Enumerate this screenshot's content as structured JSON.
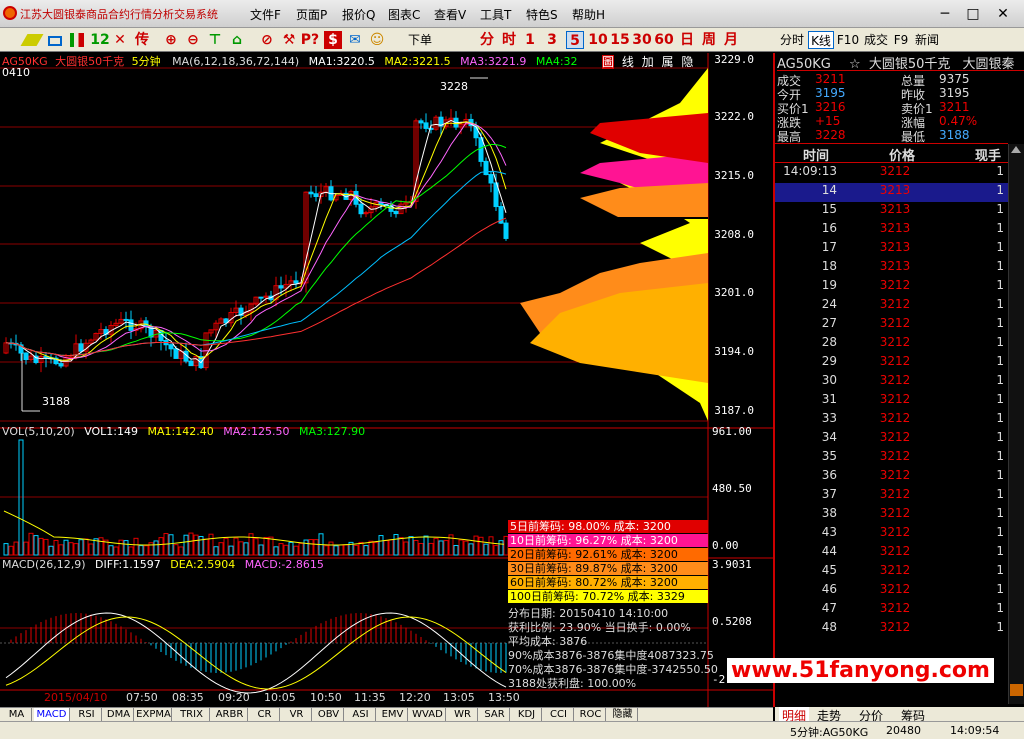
{
  "title": "江苏大圆银泰商品合约行情分析交易系统",
  "menu": [
    "文件F",
    "页面P",
    "报价Q",
    "图表C",
    "查看V",
    "工具T",
    "特色S",
    "帮助H"
  ],
  "window_buttons": [
    "─",
    "□",
    "✕"
  ],
  "toolbar": {
    "items": [
      "12",
      "传",
      "下单",
      "分",
      "时",
      "1",
      "3",
      "5",
      "10",
      "15",
      "30",
      "60",
      "日",
      "周",
      "月"
    ],
    "right_items": [
      "分时",
      "K线",
      "F10",
      "成交",
      "F9",
      "新闻"
    ]
  },
  "chart_header": {
    "symbol": "AG50KG",
    "name": "大圆银50千克",
    "period": "5分钟",
    "ma_label": "MA(6,12,18,36,72,144)",
    "ma1": "MA1:3220.5",
    "ma2": "MA2:3221.5",
    "ma3": "MA3:3221.9",
    "ma4": "MA4:32",
    "extra": "圖",
    "toggles": [
      "线",
      "加",
      "属",
      "隐"
    ],
    "date_tag": "0410"
  },
  "price_axis": [
    "3229.0",
    "3222.0",
    "3215.0",
    "3208.0",
    "3201.0",
    "3194.0",
    "3187.0"
  ],
  "price_labels": {
    "high": "3228",
    "low": "3188"
  },
  "vol_header": {
    "label": "VOL(5,10,20)",
    "vol1": "VOL1:149",
    "ma1": "MA1:142.40",
    "ma2": "MA2:125.50",
    "ma3": "MA3:127.90"
  },
  "vol_axis": [
    "961.00",
    "480.50",
    "0.00"
  ],
  "macd_header": {
    "label": "MACD(26,12,9)",
    "diff": "DIFF:1.1597",
    "dea": "DEA:2.5904",
    "macd": "MACD:-2.8615"
  },
  "macd_axis": [
    "3.9031",
    "0.5208",
    "-2."
  ],
  "time_axis": [
    "2015/04/10",
    "07:50",
    "08:35",
    "09:20",
    "10:05",
    "10:50",
    "11:35",
    "12:20",
    "13:05",
    "13:50"
  ],
  "chips": [
    {
      "text": "5日前筹码: 98.00%  成本: 3200",
      "color": "#e00000"
    },
    {
      "text": "10日前筹码: 96.27%  成本: 3200",
      "color": "#ff1493"
    },
    {
      "text": "20日前筹码: 92.61%  成本: 3200",
      "color": "#ff6a00"
    },
    {
      "text": "30日前筹码: 89.87%  成本: 3200",
      "color": "#ff8c1a"
    },
    {
      "text": "60日前筹码: 80.72%  成本: 3200",
      "color": "#ffb000"
    },
    {
      "text": "100日前筹码: 70.72%  成本: 3329",
      "color": "#ffff00"
    }
  ],
  "chip_info": [
    "分布日期: 20150410  14:10:00",
    "获利比例: 23.90%   当日换手: 0.00%",
    "平均成本: 3876",
    "90%成本3876-3876集中度4087323.75",
    "70%成本3876-3876集中度-3742550.50",
    "3188处获利盘: 100.00%"
  ],
  "bottom_tabs": [
    "MA",
    "MACD",
    "RSI",
    "DMA",
    "EXPMA",
    "TRIX",
    "ARBR",
    "CR",
    "VR",
    "OBV",
    "ASI",
    "EMV",
    "WVAD",
    "WR",
    "SAR",
    "KDJ",
    "CCI",
    "ROC",
    "隐藏"
  ],
  "quote": {
    "code": "AG50KG",
    "star": "☆",
    "name": "大圆银50千克",
    "name_extra": "大圆银秦",
    "rows": [
      {
        "l1": "成交",
        "v1": "3211",
        "c1": "#e00",
        "l2": "总量",
        "v2": "9375",
        "c2": "#ddd"
      },
      {
        "l1": "今开",
        "v1": "3195",
        "c1": "#4af",
        "l2": "昨收",
        "v2": "3195",
        "c2": "#ddd"
      },
      {
        "l1": "买价1",
        "v1": "3216",
        "c1": "#e00",
        "l2": "卖价1",
        "v2": "3211",
        "c2": "#e00"
      },
      {
        "l1": "涨跌",
        "v1": "+15",
        "c1": "#e00",
        "l2": "涨幅",
        "v2": "0.47%",
        "c2": "#e00"
      },
      {
        "l1": "最高",
        "v1": "3228",
        "c1": "#e00",
        "l2": "最低",
        "v2": "3188",
        "c2": "#4af"
      }
    ]
  },
  "ticks_header": {
    "time": "时间",
    "price": "价格",
    "qty": "现手"
  },
  "ticks": [
    {
      "time": "14:09:13",
      "price": "3212",
      "qty": "1"
    },
    {
      "time": "14",
      "price": "3213",
      "qty": "1"
    },
    {
      "time": "15",
      "price": "3213",
      "qty": "1"
    },
    {
      "time": "16",
      "price": "3213",
      "qty": "1"
    },
    {
      "time": "17",
      "price": "3213",
      "qty": "1"
    },
    {
      "time": "18",
      "price": "3213",
      "qty": "1"
    },
    {
      "time": "19",
      "price": "3212",
      "qty": "1"
    },
    {
      "time": "24",
      "price": "3212",
      "qty": "1"
    },
    {
      "time": "27",
      "price": "3212",
      "qty": "1"
    },
    {
      "time": "28",
      "price": "3212",
      "qty": "1"
    },
    {
      "time": "29",
      "price": "3212",
      "qty": "1"
    },
    {
      "time": "30",
      "price": "3212",
      "qty": "1"
    },
    {
      "time": "31",
      "price": "3212",
      "qty": "1"
    },
    {
      "time": "33",
      "price": "3212",
      "qty": "1"
    },
    {
      "time": "34",
      "price": "3212",
      "qty": "1"
    },
    {
      "time": "35",
      "price": "3212",
      "qty": "1"
    },
    {
      "time": "36",
      "price": "3212",
      "qty": "1"
    },
    {
      "time": "37",
      "price": "3212",
      "qty": "1"
    },
    {
      "time": "38",
      "price": "3212",
      "qty": "1"
    },
    {
      "time": "43",
      "price": "3212",
      "qty": "1"
    },
    {
      "time": "44",
      "price": "3212",
      "qty": "1"
    },
    {
      "time": "45",
      "price": "3212",
      "qty": "1"
    },
    {
      "time": "46",
      "price": "3212",
      "qty": "1"
    },
    {
      "time": "47",
      "price": "3212",
      "qty": "1"
    },
    {
      "time": "48",
      "price": "3212",
      "qty": "1"
    }
  ],
  "right_tabs": [
    "明细",
    "走势",
    "分价",
    "筹码"
  ],
  "status": {
    "period": "5分钟:AG50KG",
    "vol": "20480",
    "time": "14:09:54"
  },
  "watermark": "www.51fanyong.com",
  "colors": {
    "up": "#e00000",
    "down": "#00d0ff",
    "chip_yellow": "#ffff00",
    "grid": "#8b0000"
  }
}
